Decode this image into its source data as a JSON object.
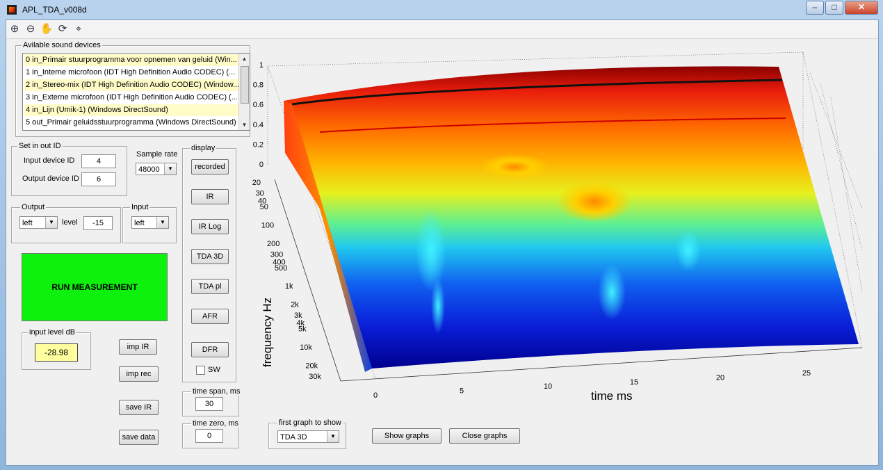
{
  "window": {
    "title": "APL_TDA_v008d"
  },
  "sound_devices": {
    "legend": "Avilable sound devices",
    "items": [
      "0 in_Primair stuurprogramma voor opnemen van geluid (Win...",
      "1 in_Interne microfoon (IDT High Definition Audio CODEC) (...",
      "2 in_Stereo-mix (IDT High Definition Audio CODEC) (Window...",
      "3 in_Externe microfoon (IDT High Definition Audio CODEC) (...",
      "4 in_Lijn (Umik-1) (Windows DirectSound)",
      "5 out_Primair geluidsstuurprogramma (Windows DirectSound)"
    ]
  },
  "set_in_out": {
    "legend": "Set in out ID",
    "input_label": "Input device ID",
    "input_value": "4",
    "output_label": "Output device ID",
    "output_value": "6"
  },
  "sample_rate": {
    "label": "Sample rate",
    "value": "48000"
  },
  "output": {
    "legend": "Output",
    "channel": "left",
    "level_label": "level",
    "level_value": "-15"
  },
  "input": {
    "legend": "Input",
    "channel": "left"
  },
  "run_label": "RUN MEASUREMENT",
  "input_level": {
    "legend": "input level dB",
    "value": "-28.98"
  },
  "side_buttons": {
    "imp_ir": "imp IR",
    "imp_rec": "imp rec",
    "save_ir": "save IR",
    "save_data": "save data"
  },
  "display": {
    "legend": "display",
    "buttons": [
      "recorded",
      "IR",
      "IR Log",
      "TDA 3D",
      "TDA pl",
      "AFR",
      "DFR"
    ],
    "sw_label": "SW"
  },
  "time_span": {
    "legend": "time span, ms",
    "value": "30"
  },
  "time_zero": {
    "legend": "time zero, ms",
    "value": "0"
  },
  "first_graph": {
    "legend": "first graph to show",
    "value": "TDA 3D"
  },
  "show_graphs": "Show graphs",
  "close_graphs": "Close graphs",
  "chart_data": {
    "type": "surface3d",
    "xlabel": "time  ms",
    "ylabel": "frequency  Hz",
    "x_ticks": [
      "0",
      "5",
      "10",
      "15",
      "20",
      "25"
    ],
    "y_ticks": [
      "20",
      "30",
      "40",
      "50",
      "100",
      "200",
      "300",
      "400",
      "500",
      "1k",
      "2k",
      "3k",
      "4k",
      "5k",
      "10k",
      "20k",
      "30k"
    ],
    "z_ticks": [
      "0",
      "0.2",
      "0.4",
      "0.6",
      "0.8",
      "1"
    ],
    "xlim": [
      0,
      30
    ],
    "ylim_hz": [
      20,
      30000
    ],
    "zlim": [
      0,
      1
    ],
    "colormap": "jet",
    "grid": true
  }
}
